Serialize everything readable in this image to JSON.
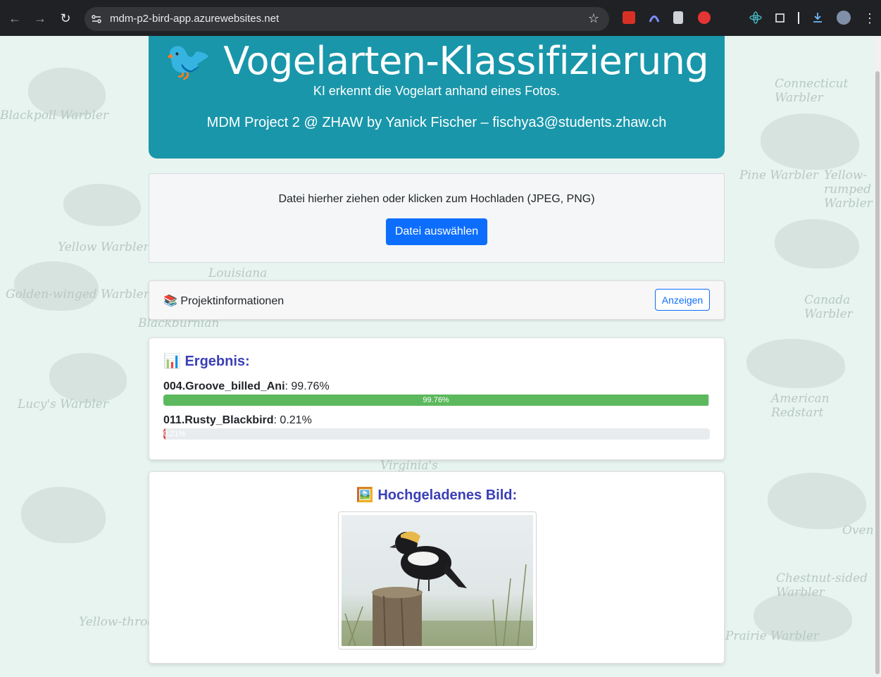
{
  "browser": {
    "url": "mdm-p2-bird-app.azurewebsites.net"
  },
  "header": {
    "title": "🐦 Vogelarten-Klassifizierung",
    "subtitle": "KI erkennt die Vogelart anhand eines Fotos.",
    "credits": "MDM Project 2 @ ZHAW by Yanick Fischer – fischya3@students.zhaw.ch"
  },
  "upload": {
    "hint": "Datei hierher ziehen oder klicken zum Hochladen (JPEG, PNG)",
    "button_label": "Datei auswählen"
  },
  "project_info": {
    "title": "📚 Projektinformationen",
    "button_label": "Anzeigen"
  },
  "result": {
    "title": "📊 Ergebnis:",
    "predictions": [
      {
        "name": "004.Groove_billed_Ani",
        "percent_text": ": 99.76%",
        "bar_text": "99.76%",
        "value": 99.76,
        "color": "#5cb85c"
      },
      {
        "name": "011.Rusty_Blackbird",
        "percent_text": ": 0.21%",
        "bar_text": "0.21%",
        "value": 0.21,
        "color": "#d9534f"
      }
    ]
  },
  "uploaded_image": {
    "title": "🖼️ Hochgeladenes Bild:"
  },
  "background_words": [
    "Blackpoll Warbler",
    "Yellow Warbler",
    "Golden-winged Warbler",
    "Louisiana",
    "Blackburnian",
    "Lucy's Warbler",
    "Connecticut Warbler",
    "Pine Warbler",
    "Yellow-rumped Warbler",
    "Canada Warbler",
    "American Redstart",
    "Chestnut-sided Warbler",
    "Ovenbird",
    "Prairie Warbler",
    "Virginia's",
    "Yellow-throated Warbler"
  ]
}
